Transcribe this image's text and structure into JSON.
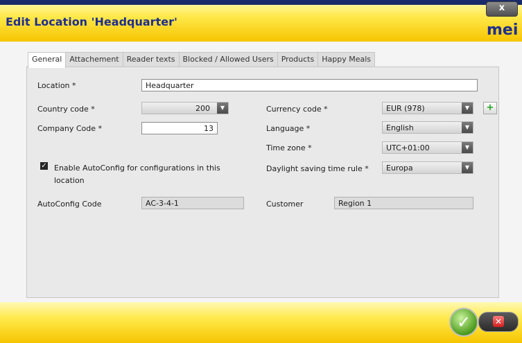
{
  "window": {
    "title": "Edit Location 'Headquarter'",
    "logo_text": "mei",
    "close_label": "x"
  },
  "tabs": [
    {
      "label": "General"
    },
    {
      "label": "Attachement"
    },
    {
      "label": "Reader texts"
    },
    {
      "label": "Blocked / Allowed Users"
    },
    {
      "label": "Products"
    },
    {
      "label": "Happy Meals"
    }
  ],
  "form": {
    "location": {
      "label": "Location *",
      "value": "Headquarter"
    },
    "country_code": {
      "label": "Country code *",
      "value": "200"
    },
    "company_code": {
      "label": "Company Code *",
      "value": "13"
    },
    "currency_code": {
      "label": "Currency code *",
      "value": "EUR (978)"
    },
    "language": {
      "label": "Language *",
      "value": "English"
    },
    "time_zone": {
      "label": "Time zone *",
      "value": "UTC+01:00"
    },
    "dst_rule": {
      "label": "Daylight saving time rule *",
      "value": "Europa"
    },
    "autoconfig_checkbox": {
      "label_line1": "Enable AutoConfig for configurations in this",
      "label_line2": "location",
      "checked": true
    },
    "autoconfig_code": {
      "label": "AutoConfig Code",
      "value": "AC-3-4-1"
    },
    "customer": {
      "label": "Customer",
      "value": "Region 1"
    }
  },
  "icons": {
    "add": "+",
    "dropdown": "▼",
    "check": "✓",
    "ok": "✓",
    "cancel": "✕"
  },
  "colors": {
    "header_yellow": "#f6c500",
    "title_blue": "#1f2f8c",
    "ok_green": "#4a9a1b",
    "cancel_red": "#cf1e1e"
  }
}
